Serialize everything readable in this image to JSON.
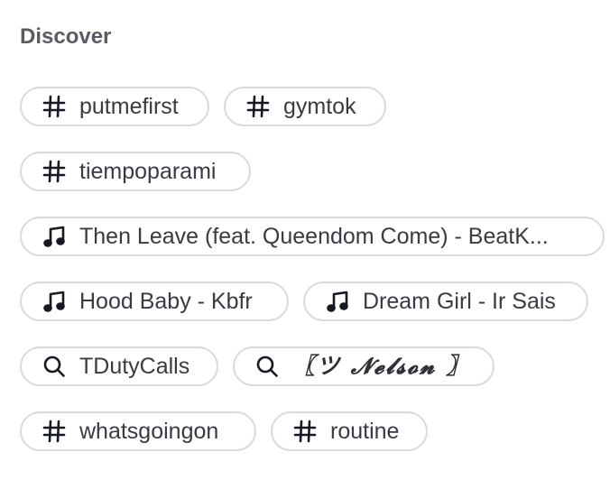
{
  "section": {
    "title": "Discover"
  },
  "chips": [
    {
      "type": "hashtag",
      "icon": "hashtag-icon",
      "label": "putmefirst"
    },
    {
      "type": "hashtag",
      "icon": "hashtag-icon",
      "label": "gymtok"
    },
    {
      "type": "hashtag",
      "icon": "hashtag-icon",
      "label": "tiempoparami"
    },
    {
      "type": "sound",
      "icon": "music-note-icon",
      "label": "Then Leave (feat. Queendom Come) - BeatK..."
    },
    {
      "type": "sound",
      "icon": "music-note-icon",
      "label": "Hood Baby - Kbfr"
    },
    {
      "type": "sound",
      "icon": "music-note-icon",
      "label": "Dream Girl - Ir Sais"
    },
    {
      "type": "search",
      "icon": "search-icon",
      "label": "TDutyCalls"
    },
    {
      "type": "search",
      "icon": "search-icon",
      "label": "〖ツ 𝓝𝓮𝓵𝓼𝓸𝓷 〗"
    },
    {
      "type": "hashtag",
      "icon": "hashtag-icon",
      "label": "whatsgoingon"
    },
    {
      "type": "hashtag",
      "icon": "hashtag-icon",
      "label": "routine"
    }
  ],
  "colors": {
    "border": "#dadadc",
    "text": "#3a3b42",
    "title": "#5b5c63",
    "icon": "#161823"
  }
}
